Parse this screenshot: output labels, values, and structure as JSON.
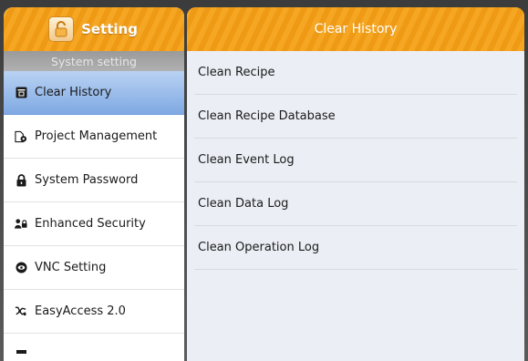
{
  "left_panel": {
    "setting_label": "Setting",
    "section_title": "System setting",
    "items": [
      {
        "label": "Clear History",
        "icon": "trash-box-icon",
        "active": true
      },
      {
        "label": "Project Management",
        "icon": "document-gear-icon",
        "active": false
      },
      {
        "label": "System Password",
        "icon": "lock-icon",
        "active": false
      },
      {
        "label": "Enhanced Security",
        "icon": "users-lock-icon",
        "active": false
      },
      {
        "label": "VNC Setting",
        "icon": "eye-circle-icon",
        "active": false
      },
      {
        "label": "EasyAccess 2.0",
        "icon": "network-icon",
        "active": false
      }
    ]
  },
  "right_panel": {
    "title": "Clear History",
    "actions": [
      {
        "label": "Clean Recipe"
      },
      {
        "label": "Clean Recipe Database"
      },
      {
        "label": "Clean Event Log"
      },
      {
        "label": "Clean Data Log"
      },
      {
        "label": "Clean Operation Log"
      }
    ]
  },
  "colors": {
    "header_orange": "#f29b16",
    "active_blue": "#7fa9e3",
    "section_gray": "#9a9a9a",
    "right_bg": "#ebeef4"
  }
}
